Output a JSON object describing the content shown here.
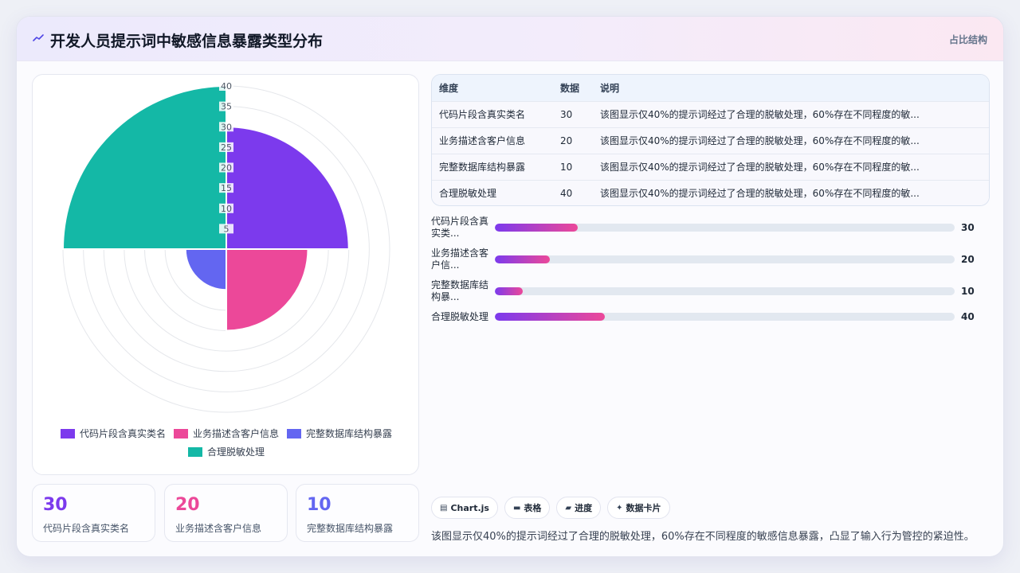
{
  "header": {
    "title": "开发人员提示词中敏感信息暴露类型分布",
    "tag": "占比结构"
  },
  "colors": {
    "series": [
      "#7c3aed",
      "#ec4899",
      "#6366f1",
      "#14b8a6"
    ]
  },
  "chart_data": {
    "type": "polarArea",
    "categories": [
      "代码片段含真实类名",
      "业务描述含客户信息",
      "完整数据库结构暴露",
      "合理脱敏处理"
    ],
    "values": [
      30,
      20,
      10,
      40
    ],
    "r_ticks": [
      5,
      10,
      15,
      20,
      25,
      30,
      35,
      40
    ],
    "r_max": 40,
    "legend_position": "bottom"
  },
  "stats": [
    {
      "value": "30",
      "label": "代码片段含真实类名",
      "color": "#7c3aed"
    },
    {
      "value": "20",
      "label": "业务描述含客户信息",
      "color": "#ec4899"
    },
    {
      "value": "10",
      "label": "完整数据库结构暴露",
      "color": "#6366f1"
    }
  ],
  "table": {
    "headers": [
      "维度",
      "数据",
      "说明"
    ],
    "rows": [
      [
        "代码片段含真实类名",
        "30",
        "该图显示仅40%的提示词经过了合理的脱敏处理，60%存在不同程度的敏..."
      ],
      [
        "业务描述含客户信息",
        "20",
        "该图显示仅40%的提示词经过了合理的脱敏处理，60%存在不同程度的敏..."
      ],
      [
        "完整数据库结构暴露",
        "10",
        "该图显示仅40%的提示词经过了合理的脱敏处理，60%存在不同程度的敏..."
      ],
      [
        "合理脱敏处理",
        "40",
        "该图显示仅40%的提示词经过了合理的脱敏处理，60%存在不同程度的敏..."
      ]
    ]
  },
  "progress": {
    "max": 40,
    "items": [
      {
        "label": "代码片段含真实类...",
        "value": 30,
        "display": "30",
        "fill": 0.18
      },
      {
        "label": "业务描述含客户信...",
        "value": 20,
        "display": "20",
        "fill": 0.12
      },
      {
        "label": "完整数据库结构暴...",
        "value": 10,
        "display": "10",
        "fill": 0.06
      },
      {
        "label": "合理脱敏处理",
        "value": 40,
        "display": "40",
        "fill": 0.24
      }
    ]
  },
  "chips": [
    {
      "icon": "chart-icon",
      "glyph": "▤",
      "label": "Chart.js"
    },
    {
      "icon": "table-icon",
      "glyph": "▬",
      "label": "表格"
    },
    {
      "icon": "progress-icon",
      "glyph": "▰",
      "label": "进度"
    },
    {
      "icon": "sparkle-icon",
      "glyph": "✦",
      "label": "数据卡片"
    }
  ],
  "summary": "该图显示仅40%的提示词经过了合理的脱敏处理，60%存在不同程度的敏感信息暴露，凸显了输入行为管控的紧迫性。"
}
